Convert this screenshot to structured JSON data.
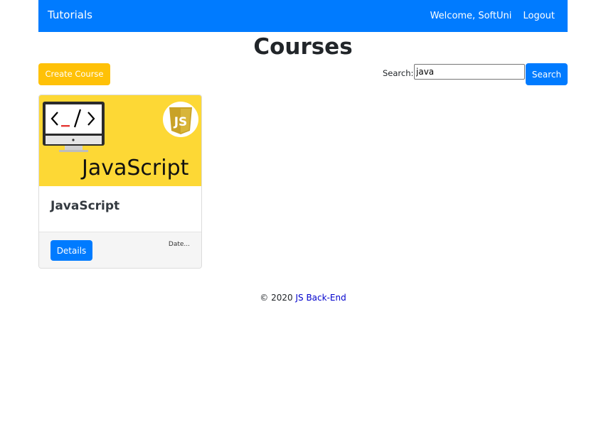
{
  "navbar": {
    "brand": "Tutorials",
    "welcome": "Welcome, SoftUni",
    "logout": "Logout",
    "color": "#007bff"
  },
  "page": {
    "title": "Courses"
  },
  "toolbar": {
    "create_label": "Create Course",
    "search_label": "Search:",
    "search_value": "java",
    "search_button": "Search"
  },
  "courses": [
    {
      "title": "JavaScript",
      "image_text": "JavaScript",
      "logo_text": "JS",
      "details_label": "Details",
      "date_label": "Date..."
    }
  ],
  "footer": {
    "copyright": "© 2020",
    "link_text": "JS Back-End"
  },
  "colors": {
    "primary": "#007bff",
    "warning": "#ffc107",
    "card_image_bg": "#fdd835"
  }
}
